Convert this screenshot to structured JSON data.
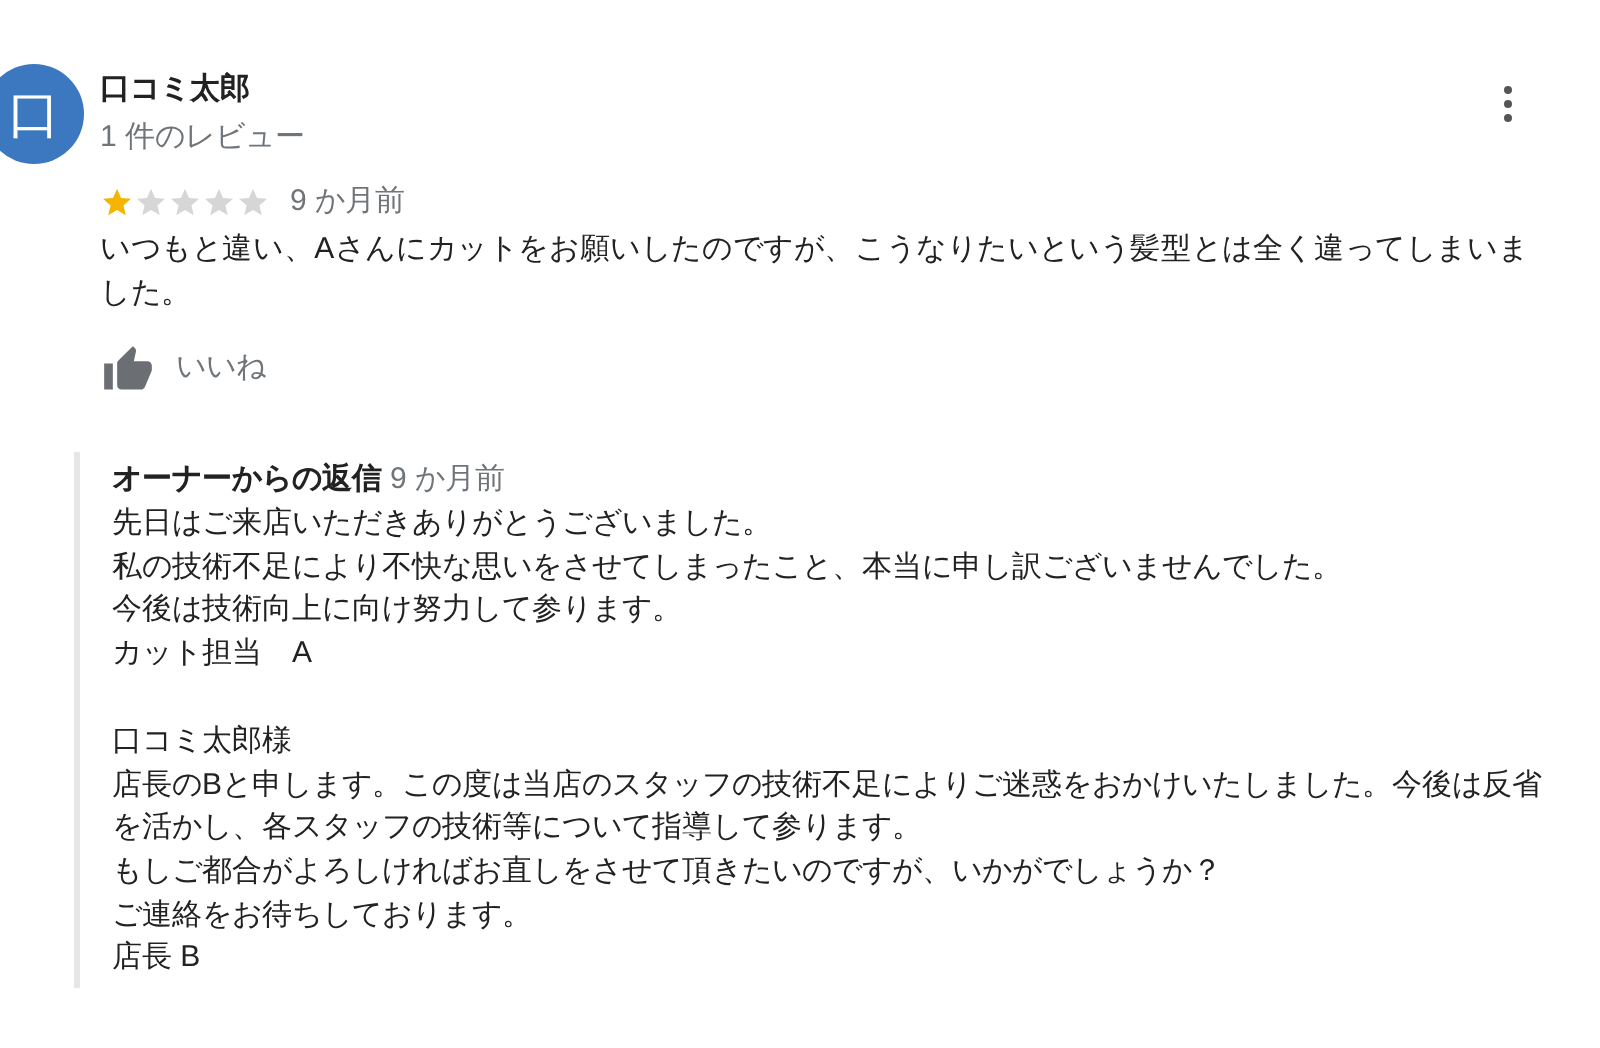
{
  "review": {
    "avatar_letter": "口",
    "author": "口コミ太郎",
    "review_count": "1 件のレビュー",
    "stars": 1,
    "time": "9 か月前",
    "text": "いつもと違い、Aさんにカットをお願いしたのですが、こうなりたいという髪型とは全く違ってしまいました。",
    "like_label": "いいね"
  },
  "owner_reply": {
    "title": "オーナーからの返信",
    "time": "9 か月前",
    "paragraphs": [
      [
        "先日はご来店いただきありがとうございました。",
        "私の技術不足により不快な思いをさせてしまったこと、本当に申し訳ございませんでした。",
        "今後は技術向上に向け努力して参ります。",
        "カット担当　A"
      ],
      [
        "口コミ太郎様",
        "店長のBと申します。この度は当店のスタッフの技術不足によりご迷惑をおかけいたしました。今後は反省を活かし、各スタッフの技術等について指導して参ります。",
        "もしご都合がよろしければお直しをさせて頂きたいのですが、いかがでしょうか？",
        "ご連絡をお待ちしております。",
        "店長 B"
      ]
    ]
  }
}
